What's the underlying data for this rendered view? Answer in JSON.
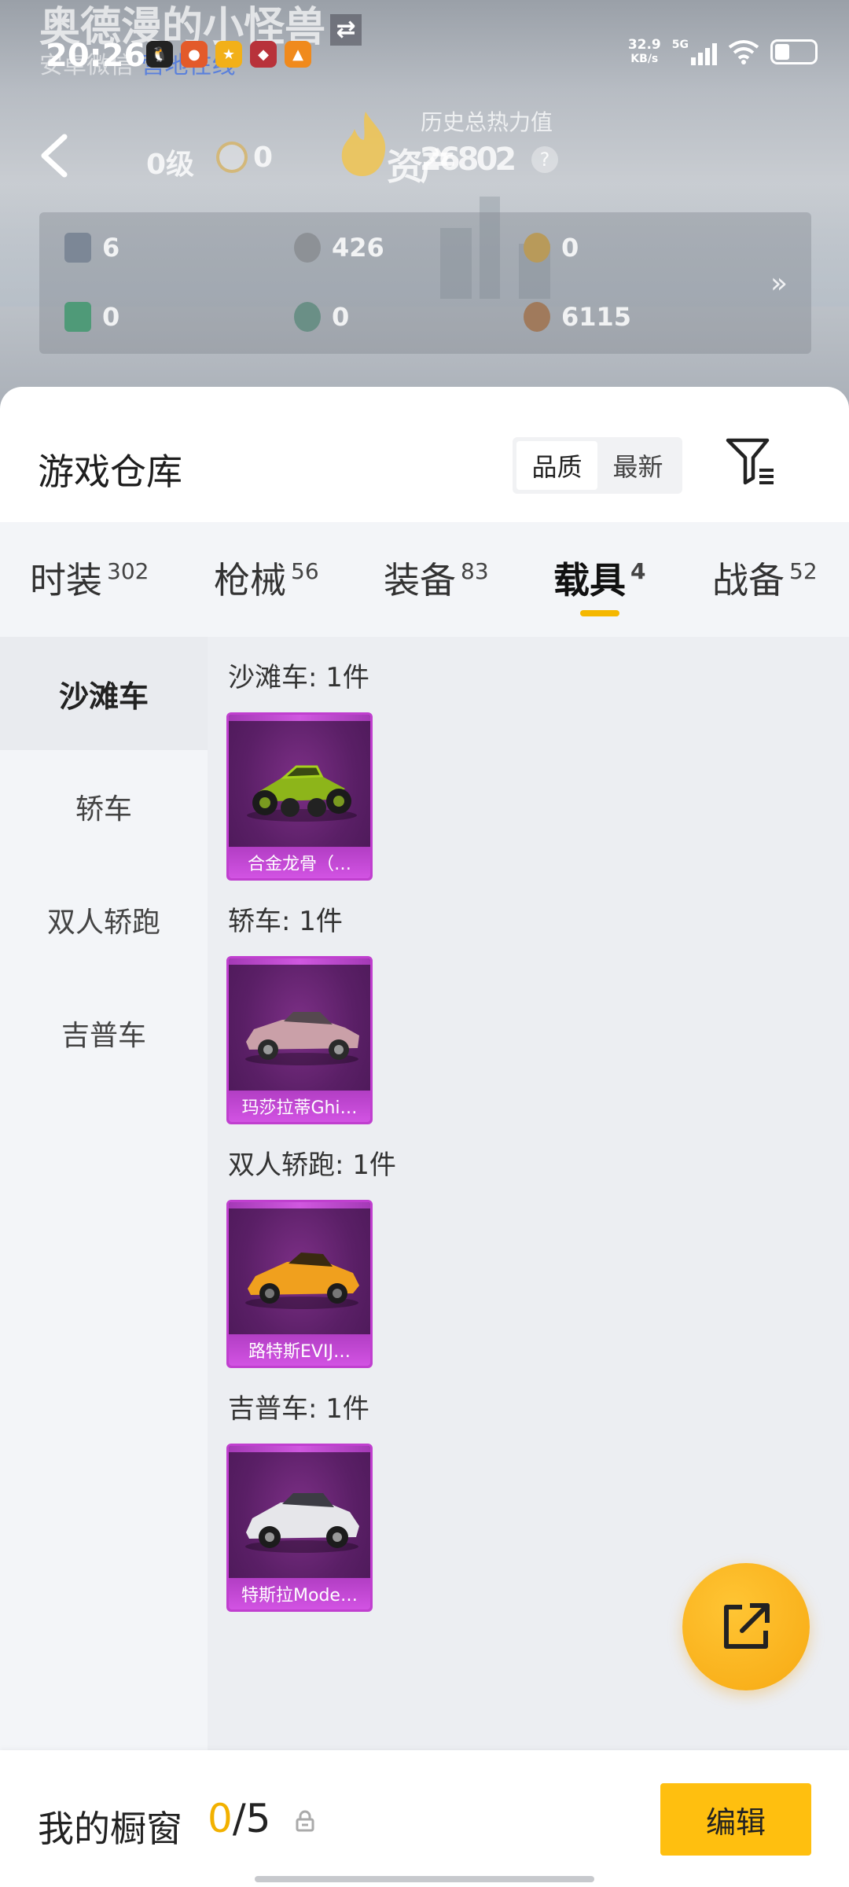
{
  "status_bar": {
    "time": "20:26",
    "net_speed_value": "32.9",
    "net_speed_unit": "KB/s",
    "signal": "5G"
  },
  "hero": {
    "ghost_name": "奥德漫的小怪兽",
    "ghost_sub": "安卓微信",
    "ghost_sub_link": "营地在线",
    "level": "0级",
    "badge_value": "0",
    "heat_label": "历史总热力值",
    "heat_overlap": "资产",
    "heat_value": "26802",
    "help": "?",
    "assets": [
      {
        "icon": "card-icon",
        "value": "6",
        "color": "#7c8796"
      },
      {
        "icon": "silver-coin-icon",
        "value": "426",
        "color": "#8d9196"
      },
      {
        "icon": "gold-emblem-icon",
        "value": "0",
        "color": "#b89a5a"
      },
      {
        "icon": "green-card-icon",
        "value": "0",
        "color": "#4f9a78"
      },
      {
        "icon": "teal-coin-icon",
        "value": "0",
        "color": "#6a8f86"
      },
      {
        "icon": "bronze-coin-icon",
        "value": "6115",
        "color": "#a07a5c"
      }
    ],
    "more": "»"
  },
  "warehouse": {
    "title": "游戏仓库",
    "sort_quality": "品质",
    "sort_latest": "最新"
  },
  "tabs": [
    {
      "label": "时装",
      "count": "302"
    },
    {
      "label": "枪械",
      "count": "56"
    },
    {
      "label": "装备",
      "count": "83"
    },
    {
      "label": "载具",
      "count": "4"
    },
    {
      "label": "战备",
      "count": "52"
    }
  ],
  "categories": [
    "沙滩车",
    "轿车",
    "双人轿跑",
    "吉普车"
  ],
  "groups": [
    {
      "title": "沙滩车: 1件",
      "item": "合金龙骨（…"
    },
    {
      "title": "轿车: 1件",
      "item": "玛莎拉蒂Ghi…"
    },
    {
      "title": "双人轿跑: 1件",
      "item": "路特斯EVIJ…"
    },
    {
      "title": "吉普车: 1件",
      "item": "特斯拉Mode…"
    }
  ],
  "showcase": {
    "label": "我的橱窗",
    "current": "0",
    "separator": "/",
    "max": "5",
    "edit": "编辑"
  },
  "colors": {
    "accent": "#ffbf0f",
    "card_purple": "#5a1f66",
    "card_border": "#c03fcf"
  }
}
